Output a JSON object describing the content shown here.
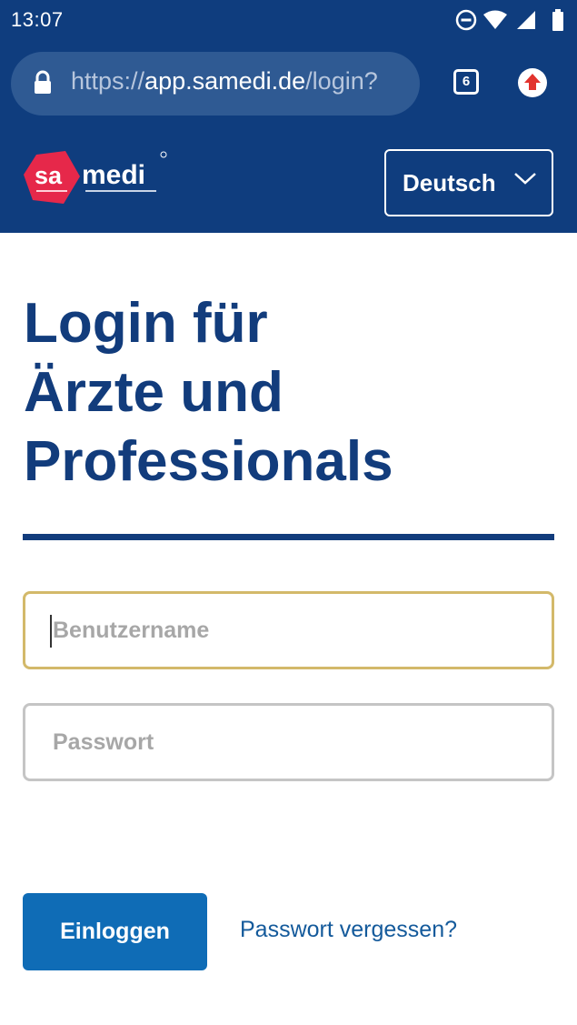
{
  "status_bar": {
    "time": "13:07",
    "icons": [
      "do-not-disturb-icon",
      "wifi-icon",
      "signal-icon",
      "battery-icon"
    ]
  },
  "browser": {
    "url_scheme": "https://",
    "url_host": "app.samedi.de",
    "url_path": "/login?",
    "tab_count": "6",
    "icons": [
      "lock-icon",
      "update-icon"
    ]
  },
  "header": {
    "logo_text": "samedi",
    "language_label": "Deutsch",
    "icons": [
      "samedi-logo",
      "chevron-down-icon"
    ]
  },
  "main": {
    "headline_lines": [
      "Login für",
      "Ärzte und",
      "Professionals"
    ],
    "username_placeholder": "Benutzername",
    "password_placeholder": "Passwort",
    "login_label": "Einloggen",
    "forgot_label": "Passwort vergessen?"
  },
  "colors": {
    "brand_navy": "#0f3d7e",
    "button_blue": "#0f6cb6",
    "logo_red": "#e6284a",
    "focus_border": "#d3b96a"
  }
}
